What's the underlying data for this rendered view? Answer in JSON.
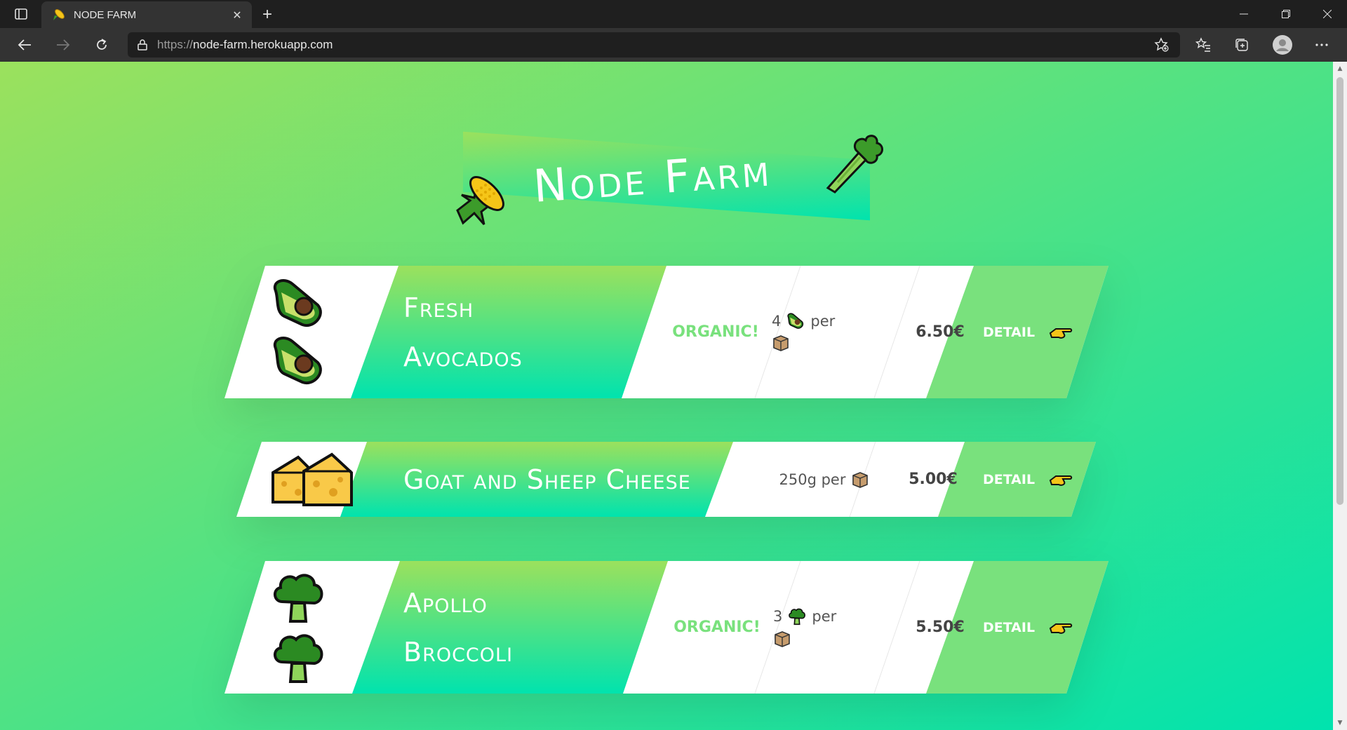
{
  "browser": {
    "tab_title": "NODE FARM",
    "url_scheme": "https://",
    "url_host": "node-farm.herokuapp.com"
  },
  "page": {
    "title": "Node Farm",
    "brand_colors": {
      "gradient_start": "#9be15d",
      "gradient_end": "#00e3ae",
      "accent": "#79e17d"
    }
  },
  "products": [
    {
      "name_line1": "Fresh",
      "name_line2": "Avocados",
      "organic_label": "ORGANIC!",
      "quantity_prefix": "4",
      "quantity_suffix": "per",
      "price": "6.50€",
      "detail_label": "DETAIL",
      "emoji": "avocado-icon"
    },
    {
      "name": "Goat and Sheep Cheese",
      "quantity_text": "250g per",
      "price": "5.00€",
      "detail_label": "DETAIL",
      "emoji": "cheese-icon"
    },
    {
      "name_line1": "Apollo",
      "name_line2": "Broccoli",
      "organic_label": "ORGANIC!",
      "quantity_prefix": "3",
      "quantity_suffix": "per",
      "price": "5.50€",
      "detail_label": "DETAIL",
      "emoji": "broccoli-icon"
    }
  ]
}
